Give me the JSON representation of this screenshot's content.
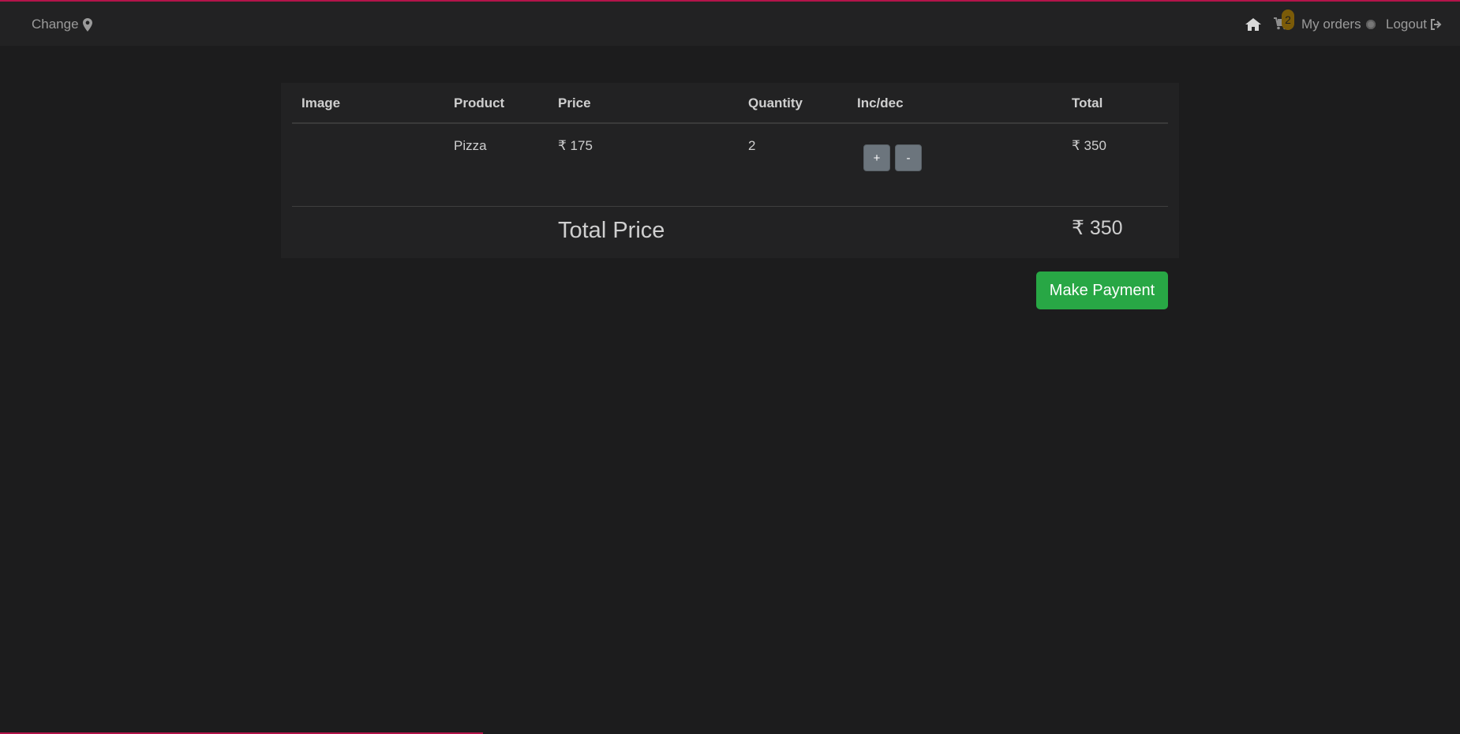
{
  "navbar": {
    "change_label": "Change",
    "cart_badge": "2",
    "orders_label": "My orders",
    "logout_label": "Logout",
    "icons": [
      "map-marker-icon",
      "home-icon",
      "cart-icon",
      "status-dot-icon",
      "logout-icon"
    ]
  },
  "cart": {
    "headers": [
      "Image",
      "Product",
      "Price",
      "Quantity",
      "Inc/dec",
      "Total"
    ],
    "rows": [
      {
        "image": "",
        "product": "Pizza",
        "price": "₹ 175",
        "quantity": "2",
        "inc_label": "+",
        "dec_label": "-",
        "total": "₹ 350"
      }
    ],
    "total_label": "Total Price",
    "total_value": "₹ 350"
  },
  "actions": {
    "pay_label": "Make Payment"
  },
  "colors": {
    "accent": "#b3144a",
    "pay": "#28a745",
    "badge": "#7b5b08"
  }
}
